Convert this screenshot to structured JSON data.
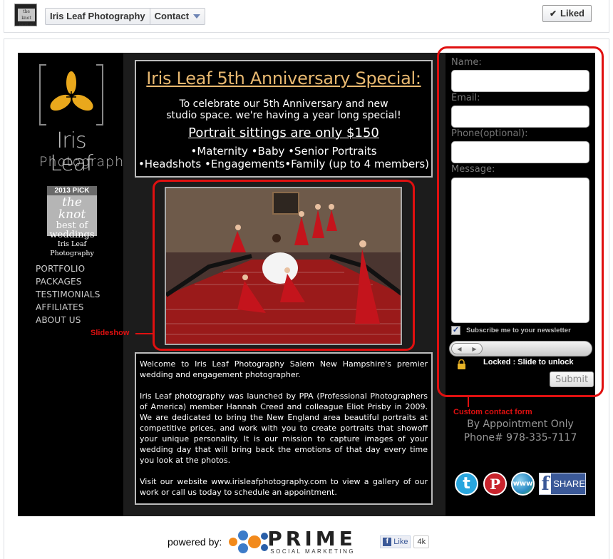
{
  "topbar": {
    "page_name": "Iris Leaf Photography",
    "tab_label": "Contact",
    "liked_label": "Liked"
  },
  "sidebar": {
    "logo_word": "Iris Leaf",
    "logo_sub": "Photography",
    "badge_year": "2013 PICK",
    "badge_line1": "the knot",
    "badge_line2": "best of",
    "badge_line3": "weddings",
    "badge_caption_1": "Iris Leaf",
    "badge_caption_2": "Photography",
    "nav": [
      {
        "label": "PORTFOLIO"
      },
      {
        "label": "PACKAGES"
      },
      {
        "label": "TESTIMONIALS"
      },
      {
        "label": "AFFILIATES"
      },
      {
        "label": "ABOUT US"
      }
    ]
  },
  "promo": {
    "title": "Iris Leaf 5th Anniversary Special:",
    "line1": "To celebrate our 5th Anniversary and new",
    "line2": "studio space. we're having a year long special!",
    "price": "Portrait sittings are only $150",
    "list1": "•Maternity •Baby •Senior Portraits",
    "list2": "•Headshots •Engagements•Family (up to 4 members)"
  },
  "welcome": {
    "p1": "Welcome to Iris Leaf Photography Salem New Hampshire's premier wedding and engagement photographer.",
    "p2": "Iris Leaf photography was launched by PPA (Professional Photographers of America) member Hannah Creed and colleague Eliot Prisby in 2009. We are dedicated to bring the New England area beautiful portraits at competitive prices, and work with you to create portraits that showoff your unique personality. It is our mission to capture images of your wedding day that will bring back the emotions of that day every time you look at the photos.",
    "p3": "Visit our website www.irisleafphotography.com to view a gallery of our work or call us today to schedule an appointment."
  },
  "form": {
    "name_label": "Name:",
    "email_label": "Email:",
    "phone_label": "Phone(optional):",
    "message_label": "Message:",
    "subscribe_label": "Subscribe me to your newsletter",
    "subscribe_checked": true,
    "lock_text": "Locked : Slide to unlock",
    "submit_label": "Submit"
  },
  "contact": {
    "appointment": "By Appointment Only",
    "phone": "Phone# 978-335-7117"
  },
  "social": {
    "twitter_glyph": "t",
    "pinterest_glyph": "P",
    "www_glyph": "www",
    "share_glyph": "f",
    "share_label": "SHARE"
  },
  "annotations": {
    "slideshow": "Slideshow",
    "contact_form": "Custom contact form"
  },
  "footer": {
    "powered_label": "powered by:",
    "brand": "PRIME",
    "brand_sub": "SOCIAL MARKETING",
    "like_label": "Like",
    "like_count": "4k"
  },
  "colors": {
    "annotation_red": "#e01010",
    "promo_title": "#e8b870",
    "facebook_blue": "#3b5998"
  }
}
